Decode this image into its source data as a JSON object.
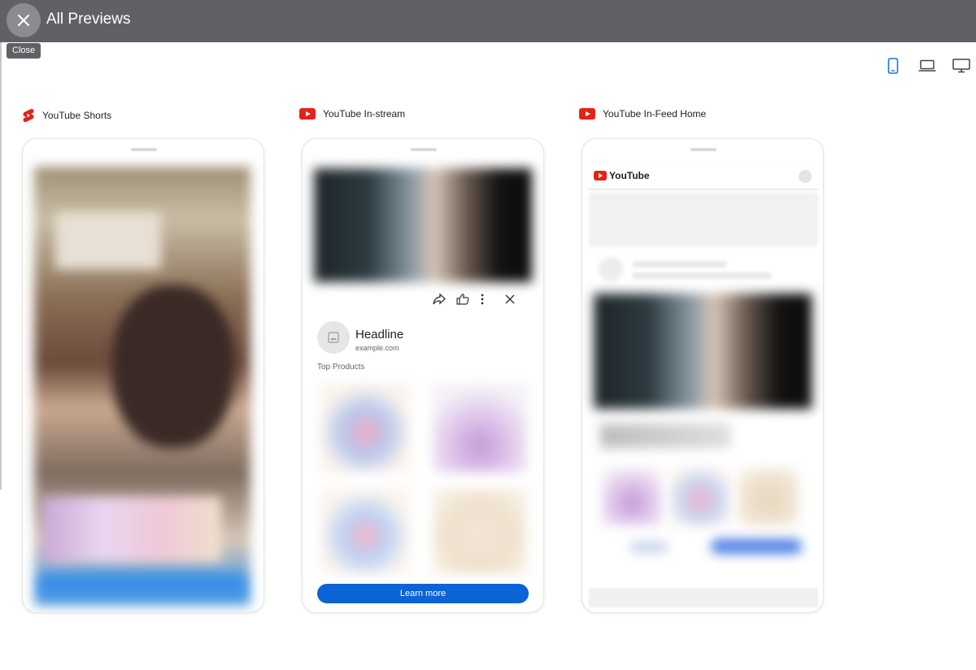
{
  "header": {
    "title": "All Previews",
    "close_tooltip": "Close"
  },
  "device_toggles": [
    {
      "name": "mobile",
      "icon": "phone-icon",
      "selected": true
    },
    {
      "name": "laptop",
      "icon": "laptop-icon",
      "selected": false
    },
    {
      "name": "desktop",
      "icon": "monitor-icon",
      "selected": false
    }
  ],
  "previews": [
    {
      "label": "YouTube Shorts",
      "icon": "youtube-shorts-icon"
    },
    {
      "label": "YouTube In-stream",
      "icon": "youtube-icon"
    },
    {
      "label": "YouTube In-Feed Home",
      "icon": "youtube-icon"
    }
  ],
  "instream": {
    "headline": "Headline",
    "domain": "example.com",
    "section": "Top Products",
    "cta": "Learn more"
  },
  "infeed": {
    "logo_text": "YouTube"
  },
  "colors": {
    "topbar": "#5f6166",
    "accent_blue": "#0b63d6",
    "youtube_red": "#e62117"
  }
}
